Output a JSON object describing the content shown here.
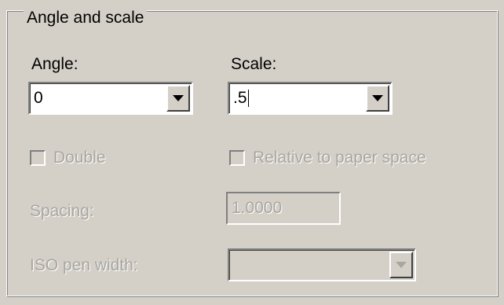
{
  "group": {
    "title": "Angle and scale"
  },
  "angle": {
    "label": "Angle:",
    "value": "0"
  },
  "scale": {
    "label": "Scale:",
    "value": ".5"
  },
  "double": {
    "label": "Double",
    "checked": false,
    "enabled": false
  },
  "relative_paper": {
    "label": "Relative to paper space",
    "checked": false,
    "enabled": false
  },
  "spacing": {
    "label": "Spacing:",
    "value": "1.0000",
    "enabled": false
  },
  "iso_pen": {
    "label": "ISO pen width:",
    "value": "",
    "enabled": false
  },
  "icons": {
    "dropdown": "chevron-down-icon",
    "checkbox": "checkbox-icon"
  }
}
